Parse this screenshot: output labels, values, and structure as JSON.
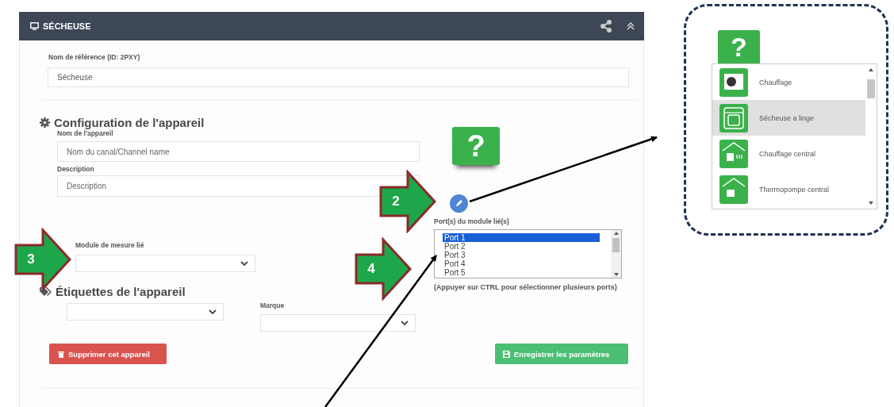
{
  "panel": {
    "title": "SÉCHEUSE",
    "reference": {
      "label": "Nom de référence (ID: 2PXY)",
      "value": "Sécheuse"
    },
    "config": {
      "heading": "Configuration de l'appareil",
      "name": {
        "label": "Nom de l'appareil",
        "placeholder": "Nom du canal/Channel name"
      },
      "description": {
        "label": "Description",
        "placeholder": "Description"
      },
      "module": {
        "label": "Module de mesure lié"
      }
    },
    "device_icon": "?",
    "tags": {
      "heading": "Étiquettes de l'appareil",
      "brand": {
        "label": "Marque"
      }
    },
    "ports": {
      "label": "Port(s) du module lié(s)",
      "items": [
        {
          "label": "Port 1",
          "selected": true
        },
        {
          "label": "Port 2",
          "selected": false
        },
        {
          "label": "Port 3",
          "selected": false
        },
        {
          "label": "Port 4",
          "selected": false
        },
        {
          "label": "Port 5",
          "selected": false
        }
      ],
      "hint": "(Appuyer sur CTRL pour sélectionner plusieurs ports)"
    },
    "buttons": [
      {
        "label": "Supprimer cet appareil",
        "kind": "danger"
      },
      {
        "label": "Enregistrer les paramètres",
        "kind": "save"
      }
    ]
  },
  "icon_picker": {
    "current_icon": "?",
    "items": [
      {
        "label": "Chauffage",
        "selected": false
      },
      {
        "label": "Sécheuse a linge",
        "selected": true
      },
      {
        "label": "Chauffage central",
        "selected": false
      },
      {
        "label": "Thermopompe central",
        "selected": false
      }
    ]
  },
  "callouts": [
    {
      "number": "2"
    },
    {
      "number": "3"
    },
    {
      "number": "4"
    }
  ]
}
